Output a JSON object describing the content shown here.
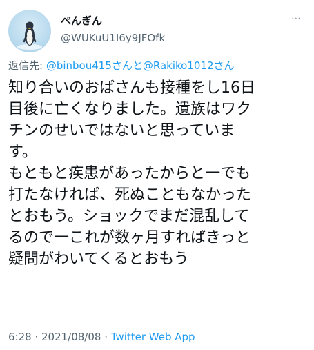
{
  "author": {
    "display_name": "ぺんぎん",
    "handle": "@WUKuU1I6y9JFOfk",
    "avatar_icon": "penguin-avatar-icon"
  },
  "more_icon": "⋯",
  "reply_to": {
    "prefix": "返信先: ",
    "mention1": "@binbou415さん",
    "joiner": "と",
    "mention2": "@Rakiko1012さん"
  },
  "tweet": {
    "text": "知り合いのおばさんも接種をし16日\n目後に亡くなりました。遺族はワク\nチンのせいではないと思っていま\nす。\nもともと疾患があったからと一でも\n打たなければ、死ぬこともなかった\nとおもう。ショックでまだ混乱して\nるので一これが数ヶ月すればきっと\n疑問がわいてくるとおもう"
  },
  "meta": {
    "timestamp": "6:28 · 2021/08/08 · ",
    "source": "Twitter Web App"
  },
  "colors": {
    "link": "#1d9bf0",
    "secondary": "#536471"
  }
}
